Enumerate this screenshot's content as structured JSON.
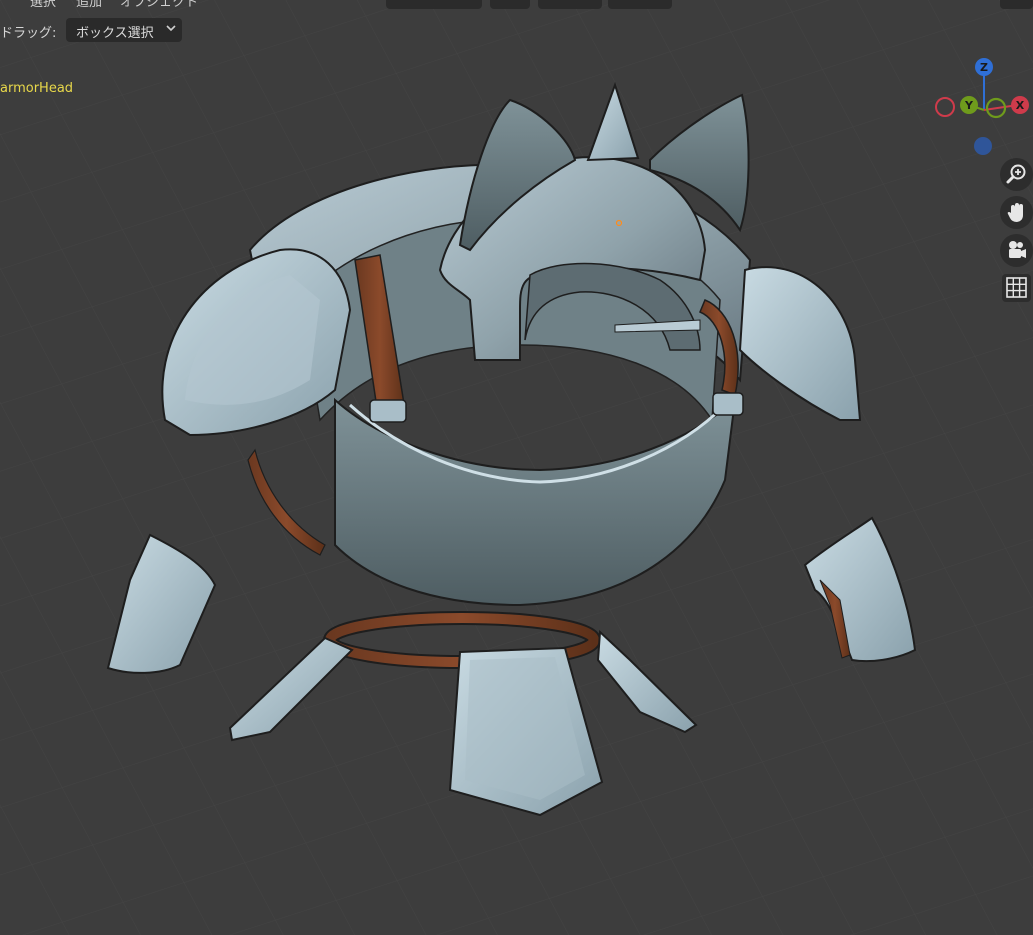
{
  "header": {
    "menu": [
      {
        "label": "選択"
      },
      {
        "label": "追加"
      },
      {
        "label": "オブジェクト"
      }
    ]
  },
  "tool_settings": {
    "drag_label": "ドラッグ:",
    "drag_value": "ボックス選択"
  },
  "viewport": {
    "active_object": "armorHead",
    "gizmo": {
      "z": "Z",
      "y": "Y",
      "x": "X"
    },
    "colors": {
      "background": "#3d3d3d",
      "object_text": "#e8d84a",
      "armor": "#9fb3bd",
      "strap": "#7a3f24"
    }
  },
  "nav_controls": {
    "zoom": "zoom-icon",
    "pan": "hand-icon",
    "camera": "camera-icon",
    "ortho": "grid-icon"
  }
}
